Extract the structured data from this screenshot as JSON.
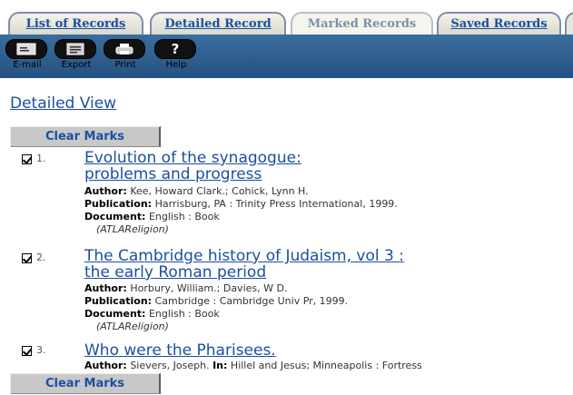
{
  "tabs": [
    {
      "label": "List of Records",
      "active": false
    },
    {
      "label": "Detailed Record",
      "active": false
    },
    {
      "label": "Marked Records",
      "active": true
    },
    {
      "label": "Saved Records",
      "active": false
    }
  ],
  "toolbar": [
    {
      "label": "E-mail",
      "icon": "email-icon"
    },
    {
      "label": "Export",
      "icon": "export-icon"
    },
    {
      "label": "Print",
      "icon": "print-icon"
    },
    {
      "label": "Help",
      "icon": "help-icon",
      "glyph": "?"
    }
  ],
  "main": {
    "view_title": "Detailed View",
    "clear_marks_label": "Clear Marks"
  },
  "records": [
    {
      "number": "1.",
      "title_line1": "Evolution of the synagogue:",
      "title_line2": "problems and progress",
      "author_label": "Author:",
      "author": "Kee, Howard Clark.; Cohick, Lynn H.",
      "publication_label": "Publication:",
      "publication": "Harrisburg, PA : Trinity Press International, 1999.",
      "document_label": "Document:",
      "document": "English : Book",
      "source": "(ATLAReligion)"
    },
    {
      "number": "2.",
      "title_line1": "The Cambridge history of Judaism, vol 3 :",
      "title_line2": "the early Roman period",
      "author_label": "Author:",
      "author": "Horbury, William.; Davies, W D.",
      "publication_label": "Publication:",
      "publication": "Cambridge : Cambridge Univ Pr, 1999.",
      "document_label": "Document:",
      "document": "English : Book",
      "source": "(ATLAReligion)"
    },
    {
      "number": "3.",
      "title_line1": "Who were the Pharisees.",
      "author_label": "Author:",
      "author": "Sievers, Joseph.",
      "in_label": "In:",
      "in_text": "Hillel and Jesus; Minneapolis : Fortress"
    }
  ],
  "colors": {
    "link": "#1d4fa0",
    "toolbar": "#2f5f8f",
    "button_bg": "#c8c8c8"
  }
}
